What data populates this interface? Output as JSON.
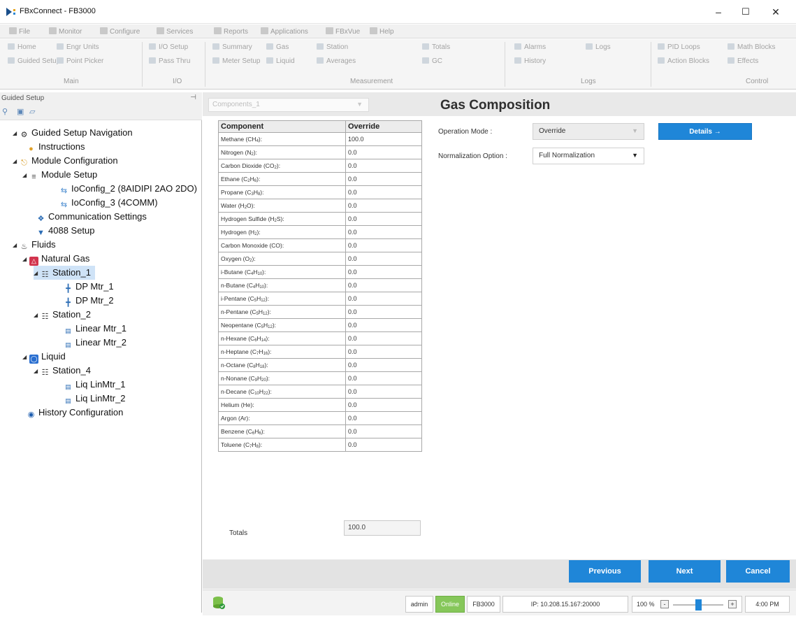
{
  "window": {
    "title": "FBxConnect - FB3000",
    "minimize": "–",
    "maximize": "☐",
    "close": "✕"
  },
  "menu": [
    "File",
    "Monitor",
    "Configure",
    "Services",
    "Reports",
    "Applications",
    "FBxVue",
    "Help"
  ],
  "ribbon": {
    "main": {
      "home": "Home",
      "engr_units": "Engr Units",
      "guided_setup": "Guided Setup",
      "point_picker": "Point Picker",
      "label": "Main"
    },
    "io": {
      "io_setup": "I/O Setup",
      "pass_thru": "Pass Thru",
      "label": "I/O"
    },
    "measurement": {
      "summary": "Summary",
      "gas": "Gas",
      "station": "Station",
      "meter_setup": "Meter Setup",
      "liquid": "Liquid",
      "averages": "Averages",
      "totals": "Totals",
      "gc": "GC",
      "label": "Measurement"
    },
    "logs": {
      "alarms": "Alarms",
      "logs": "Logs",
      "history": "History",
      "label": "Logs"
    },
    "control": {
      "pid_loops": "PID Loops",
      "math_blocks": "Math Blocks",
      "action_blocks": "Action Blocks",
      "effects": "Effects",
      "label": "Control"
    }
  },
  "left_panel": {
    "title": "Guided Setup",
    "pin": "⊣",
    "tree": [
      {
        "label": "Guided Setup Navigation",
        "icon": "gear-icon"
      },
      {
        "label": "Instructions",
        "icon": "instructions-icon"
      },
      {
        "label": "Module Configuration",
        "icon": "module-icon"
      },
      {
        "label": "Module Setup",
        "icon": "module-setup-icon"
      },
      {
        "label": "IoConfig_2 (8AIDIPI 2AO 2DO)",
        "icon": "io-icon"
      },
      {
        "label": "IoConfig_3 (4COMM)",
        "icon": "io-icon"
      },
      {
        "label": "Communication Settings",
        "icon": "comm-icon"
      },
      {
        "label": "4088 Setup",
        "icon": "transmitter-icon"
      },
      {
        "label": "Fluids",
        "icon": "fluids-icon"
      },
      {
        "label": "Natural Gas",
        "icon": "natural-gas-icon"
      },
      {
        "label": "Station_1",
        "icon": "station-icon"
      },
      {
        "label": "DP Mtr_1",
        "icon": "dp-meter-icon"
      },
      {
        "label": "DP Mtr_2",
        "icon": "dp-meter-icon"
      },
      {
        "label": "Station_2",
        "icon": "station-icon"
      },
      {
        "label": "Linear Mtr_1",
        "icon": "linear-meter-icon"
      },
      {
        "label": "Linear Mtr_2",
        "icon": "linear-meter-icon"
      },
      {
        "label": "Liquid",
        "icon": "liquid-icon"
      },
      {
        "label": "Station_4",
        "icon": "station-icon"
      },
      {
        "label": "Liq LinMtr_1",
        "icon": "linear-meter-icon"
      },
      {
        "label": "Liq LinMtr_2",
        "icon": "linear-meter-icon"
      },
      {
        "label": "History Configuration",
        "icon": "history-icon"
      }
    ]
  },
  "station_select": "Components_1",
  "page_title": "Gas Composition",
  "table": {
    "headers": [
      "Component",
      "Override"
    ],
    "rows": [
      {
        "name": "Methane (CH",
        "sub": "4",
        "tail": "):",
        "value": "100.0"
      },
      {
        "name": "Nitrogen (N",
        "sub": "2",
        "tail": "):",
        "value": "0.0"
      },
      {
        "name": "Carbon Dioxide (CO",
        "sub": "2",
        "tail": "):",
        "value": "0.0"
      },
      {
        "name": "Ethane (C",
        "sub": "2",
        "tail": "H",
        "sub2": "6",
        "tail2": "):",
        "value": "0.0"
      },
      {
        "name": "Propane (C",
        "sub": "3",
        "tail": "H",
        "sub2": "8",
        "tail2": "):",
        "value": "0.0"
      },
      {
        "name": "Water (H",
        "sub": "2",
        "tail": "O):",
        "value": "0.0"
      },
      {
        "name": "Hydrogen Sulfide (H",
        "sub": "2",
        "tail": "S):",
        "value": "0.0"
      },
      {
        "name": "Hydrogen (H",
        "sub": "2",
        "tail": "):",
        "value": "0.0"
      },
      {
        "name": "Carbon Monoxide (CO):",
        "value": "0.0"
      },
      {
        "name": "Oxygen (O",
        "sub": "2",
        "tail": "):",
        "value": "0.0"
      },
      {
        "name": "i-Butane (C",
        "sub": "4",
        "tail": "H",
        "sub2": "10",
        "tail2": "):",
        "value": "0.0"
      },
      {
        "name": "n-Butane (C",
        "sub": "4",
        "tail": "H",
        "sub2": "10",
        "tail2": "):",
        "value": "0.0"
      },
      {
        "name": "i-Pentane (C",
        "sub": "5",
        "tail": "H",
        "sub2": "12",
        "tail2": "):",
        "value": "0.0"
      },
      {
        "name": "n-Pentane (C",
        "sub": "5",
        "tail": "H",
        "sub2": "12",
        "tail2": "):",
        "value": "0.0"
      },
      {
        "name": "Neopentane (C",
        "sub": "5",
        "tail": "H",
        "sub2": "12",
        "tail2": "):",
        "value": "0.0"
      },
      {
        "name": "n-Hexane (C",
        "sub": "6",
        "tail": "H",
        "sub2": "14",
        "tail2": "):",
        "value": "0.0"
      },
      {
        "name": "n-Heptane (C",
        "sub": "7",
        "tail": "H",
        "sub2": "16",
        "tail2": "):",
        "value": "0.0"
      },
      {
        "name": "n-Octane (C",
        "sub": "8",
        "tail": "H",
        "sub2": "18",
        "tail2": "):",
        "value": "0.0"
      },
      {
        "name": "n-Nonane (C",
        "sub": "9",
        "tail": "H",
        "sub2": "20",
        "tail2": "):",
        "value": "0.0"
      },
      {
        "name": "n-Decane (C",
        "sub": "10",
        "tail": "H",
        "sub2": "22",
        "tail2": "):",
        "value": "0.0"
      },
      {
        "name": "Helium (He):",
        "value": "0.0"
      },
      {
        "name": "Argon (Ar):",
        "value": "0.0"
      },
      {
        "name": "Benzene (C",
        "sub": "6",
        "tail": "H",
        "sub2": "6",
        "tail2": "):",
        "value": "0.0"
      },
      {
        "name": "Toluene (C",
        "sub": "7",
        "tail": "H",
        "sub2": "8",
        "tail2": "):",
        "value": "0.0"
      }
    ],
    "totals_label": "Totals",
    "totals_value": "100.0"
  },
  "form": {
    "operation_mode_label": "Operation Mode :",
    "operation_mode_value": "Override",
    "normalization_label": "Normalization Option :",
    "normalization_value": "Full Normalization",
    "details_button": "Details →"
  },
  "nav": {
    "previous": "Previous",
    "next": "Next",
    "cancel": "Cancel"
  },
  "status": {
    "user": "admin",
    "connection": "Online",
    "device": "FB3000",
    "ip": "IP: 10.208.15.167:20000",
    "zoom": "100 %",
    "zoom_minus": "-",
    "zoom_plus": "+",
    "zoom_level": 0.5,
    "time": "4:00 PM",
    "online_color": "#86c75a"
  },
  "colors": {
    "accent": "#1f86d8"
  }
}
